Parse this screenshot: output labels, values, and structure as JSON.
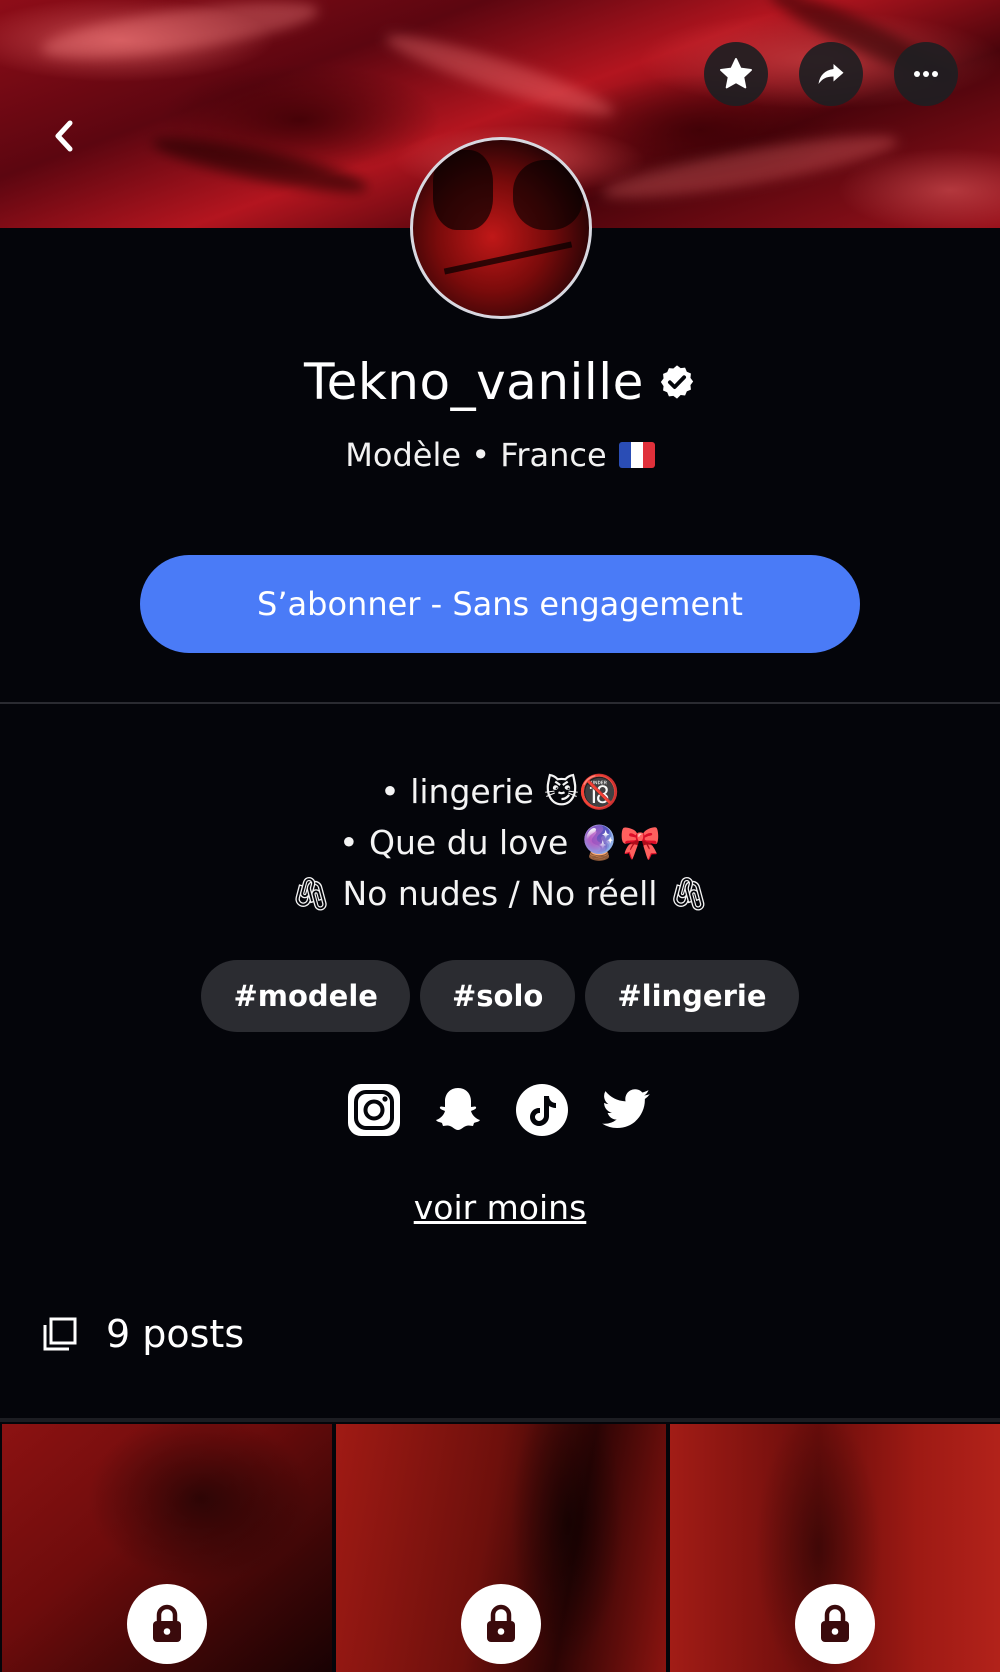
{
  "profile": {
    "name": "Tekno_vanille",
    "verified": true,
    "subtitle": "Modèle • France",
    "flag": "FR",
    "subscribe_label": "S’abonner - Sans engagement"
  },
  "header": {
    "back_icon": "chevron-left-icon",
    "favorite_icon": "star-icon",
    "share_icon": "share-arrow-icon",
    "more_icon": "ellipsis-icon"
  },
  "bio": {
    "lines": [
      "• lingerie 😼🔞",
      "• Que du love 🔮🎀",
      "🖇 No nudes / No réell 🖇"
    ]
  },
  "tags": [
    "#modele",
    "#solo",
    "#lingerie"
  ],
  "socials": [
    "instagram-icon",
    "snapchat-icon",
    "tiktok-icon",
    "twitter-icon"
  ],
  "see_less": "voir moins",
  "posts": {
    "count_label": "9 posts",
    "tiles_visible": 3,
    "locked": true
  },
  "colors": {
    "background": "#04050a",
    "accent": "#4a7bf7",
    "chip": "#2b2c31"
  }
}
